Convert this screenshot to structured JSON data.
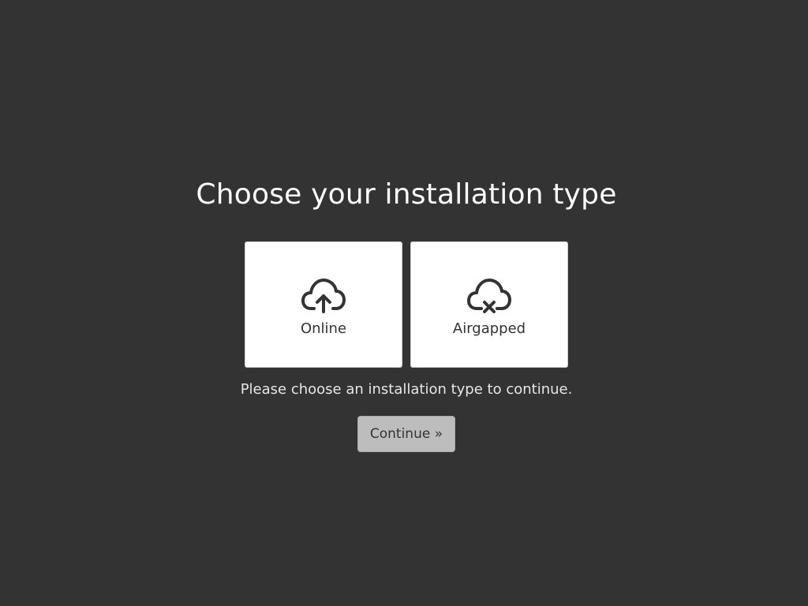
{
  "page": {
    "title": "Choose your installation type",
    "hint": "Please choose an installation type to continue."
  },
  "options": [
    {
      "label": "Online",
      "icon": "cloud-upload-icon"
    },
    {
      "label": "Airgapped",
      "icon": "cloud-offline-icon"
    }
  ],
  "actions": {
    "continue_label": "Continue »",
    "continue_enabled": false
  },
  "colors": {
    "background": "#333333",
    "card": "#ffffff",
    "icon": "#333333",
    "button_disabled": "#bdbdbd"
  }
}
